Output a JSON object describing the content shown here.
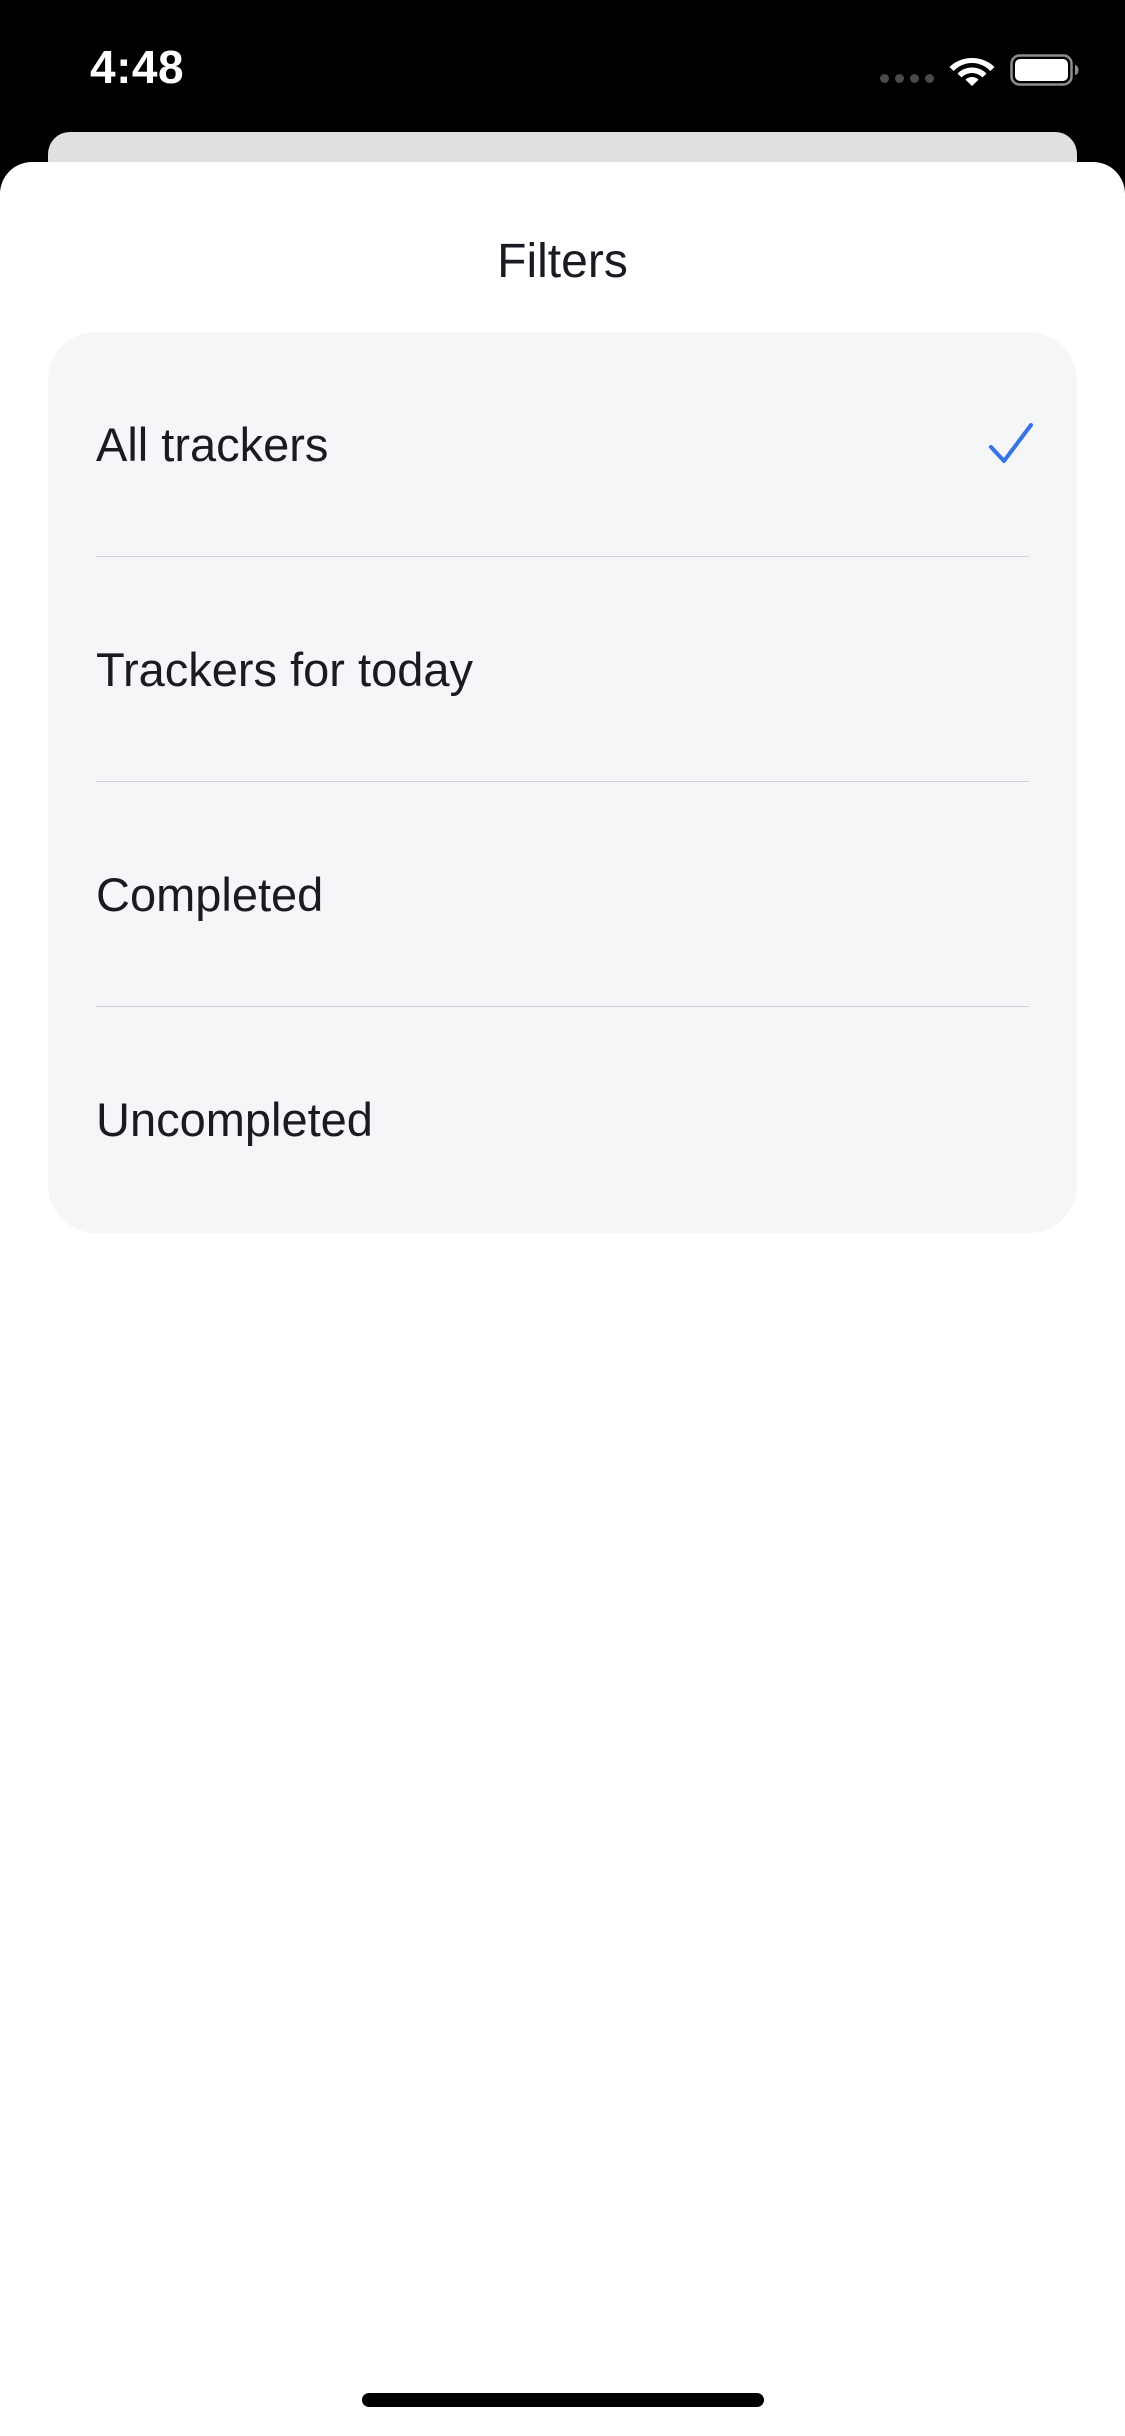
{
  "status_bar": {
    "time": "4:48",
    "wifi_icon": "wifi-icon",
    "battery_icon": "battery-icon"
  },
  "sheet": {
    "title": "Filters",
    "options": [
      {
        "label": "All trackers",
        "selected": true
      },
      {
        "label": "Trackers for today",
        "selected": false
      },
      {
        "label": "Completed",
        "selected": false
      },
      {
        "label": "Uncompleted",
        "selected": false
      }
    ],
    "check_icon": "checkmark-icon"
  },
  "colors": {
    "accent": "#3772E7",
    "text": "#1A1B22",
    "card_background": "#F5F6F8",
    "separator": "#D0D2D6"
  }
}
